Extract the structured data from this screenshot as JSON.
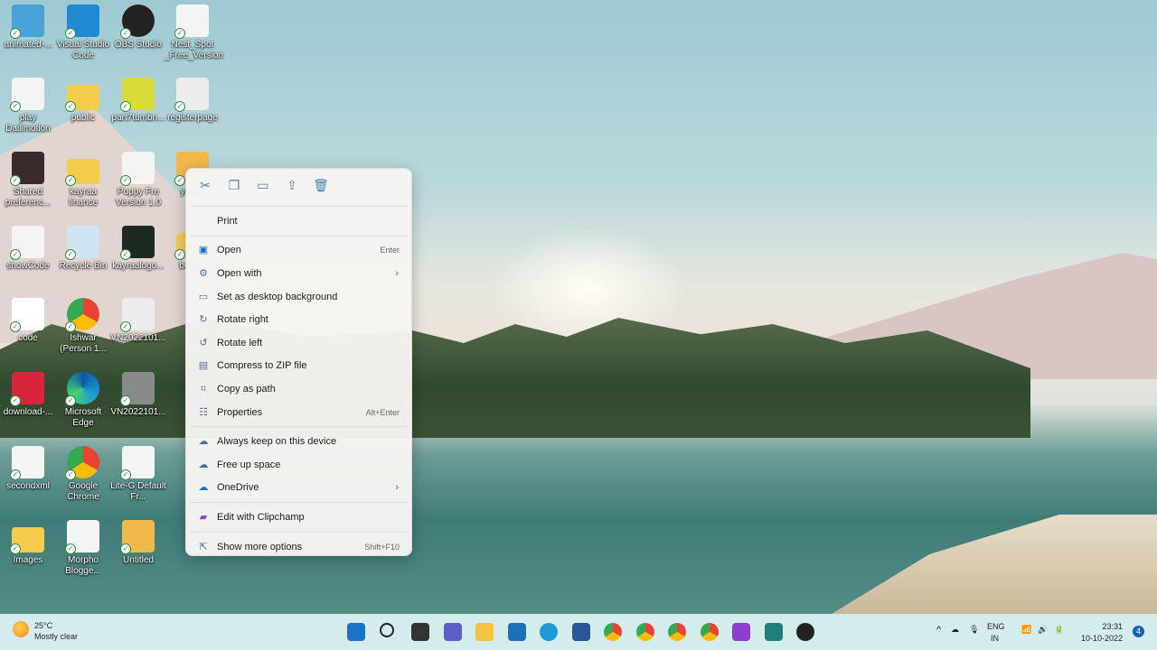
{
  "desktop_icons": [
    {
      "label": "animated-...",
      "type": "image",
      "color": "#4aa3d8",
      "col": 0,
      "row": 0
    },
    {
      "label": "Visual Studio Code",
      "type": "vscode",
      "color": "#1f8ad2",
      "col": 1,
      "row": 0
    },
    {
      "label": "OBS Studio",
      "type": "obs",
      "color": "#222222",
      "col": 2,
      "row": 0
    },
    {
      "label": "Nest_Spot _Free_Version",
      "type": "html",
      "color": "#f4f4f4",
      "col": 3,
      "row": 0
    },
    {
      "label": "play Dailimotion",
      "type": "document",
      "color": "#f4f4f4",
      "col": 0,
      "row": 1
    },
    {
      "label": "public",
      "type": "folder",
      "color": "#f5cd4d",
      "col": 1,
      "row": 1
    },
    {
      "label": "part7tumbn...",
      "type": "image",
      "color": "#d8dc3a",
      "col": 2,
      "row": 1
    },
    {
      "label": "registerpage",
      "type": "document",
      "color": "#ececec",
      "col": 3,
      "row": 1
    },
    {
      "label": "Shared preferenc...",
      "type": "image",
      "color": "#3a2a2a",
      "col": 0,
      "row": 2
    },
    {
      "label": "kayraa finance",
      "type": "folder",
      "color": "#f5cd4d",
      "col": 1,
      "row": 2
    },
    {
      "label": "Poppy Fre Version 1.0",
      "type": "html",
      "color": "#f4f4f4",
      "col": 2,
      "row": 2
    },
    {
      "label": "yout...",
      "type": "image",
      "color": "#f2b84a",
      "col": 3,
      "row": 2
    },
    {
      "label": "showCode",
      "type": "document",
      "color": "#f4f4f4",
      "col": 0,
      "row": 3
    },
    {
      "label": "Recycle Bin",
      "type": "recycle",
      "color": "#cfe4f2",
      "col": 1,
      "row": 3
    },
    {
      "label": "kayraalogo...",
      "type": "image",
      "color": "#1d2a22",
      "col": 2,
      "row": 3
    },
    {
      "label": "besti...",
      "type": "folder",
      "color": "#f5cd4d",
      "col": 3,
      "row": 3
    },
    {
      "label": "code",
      "type": "document",
      "color": "#ffffff",
      "col": 0,
      "row": 4
    },
    {
      "label": "Ishwar (Person 1...",
      "type": "chrome",
      "color": "#e2483a",
      "col": 1,
      "row": 4
    },
    {
      "label": "VN2022101...",
      "type": "document",
      "color": "#ececec",
      "col": 2,
      "row": 4
    },
    {
      "label": "download-...",
      "type": "image",
      "color": "#d8253b",
      "col": 0,
      "row": 5
    },
    {
      "label": "Microsoft Edge",
      "type": "edge",
      "color": "#1d9ad6",
      "col": 1,
      "row": 5
    },
    {
      "label": "VN2022101...",
      "type": "video",
      "color": "#8a8a8a",
      "col": 2,
      "row": 5
    },
    {
      "label": "secondxml",
      "type": "document",
      "color": "#f4f4f4",
      "col": 0,
      "row": 6
    },
    {
      "label": "Google Chrome",
      "type": "chrome",
      "color": "#e2483a",
      "col": 1,
      "row": 6
    },
    {
      "label": "Lite-G Default Fr...",
      "type": "html",
      "color": "#f4f4f4",
      "col": 2,
      "row": 6
    },
    {
      "label": "Images",
      "type": "folder",
      "color": "#f5cd4d",
      "col": 0,
      "row": 7
    },
    {
      "label": "Morpho Blogge...",
      "type": "html",
      "color": "#f4f4f4",
      "col": 1,
      "row": 7
    },
    {
      "label": "Untitled",
      "type": "image",
      "color": "#f2b84a",
      "col": 2,
      "row": 7
    }
  ],
  "context_menu": {
    "toolbar": [
      {
        "name": "cut",
        "glyph": "✂"
      },
      {
        "name": "copy",
        "glyph": "❐"
      },
      {
        "name": "rename",
        "glyph": "▭"
      },
      {
        "name": "share",
        "glyph": "⇪"
      },
      {
        "name": "delete",
        "glyph": "🗑"
      }
    ],
    "groups": [
      [
        {
          "label": "Print",
          "icon": ""
        }
      ],
      [
        {
          "label": "Open",
          "icon": "image",
          "shortcut": "Enter"
        },
        {
          "label": "Open with",
          "icon": "open-with",
          "submenu": true
        },
        {
          "label": "Set as desktop background",
          "icon": "desktop"
        },
        {
          "label": "Rotate right",
          "icon": "rotate-right"
        },
        {
          "label": "Rotate left",
          "icon": "rotate-left"
        },
        {
          "label": "Compress to ZIP file",
          "icon": "zip"
        },
        {
          "label": "Copy as path",
          "icon": "path"
        },
        {
          "label": "Properties",
          "icon": "properties",
          "shortcut": "Alt+Enter"
        }
      ],
      [
        {
          "label": "Always keep on this device",
          "icon": "cloud-keep"
        },
        {
          "label": "Free up space",
          "icon": "cloud"
        },
        {
          "label": "OneDrive",
          "icon": "onedrive",
          "submenu": true
        }
      ],
      [
        {
          "label": "Edit with Clipchamp",
          "icon": "clipchamp"
        }
      ],
      [
        {
          "label": "Show more options",
          "icon": "more",
          "shortcut": "Shift+F10"
        }
      ]
    ]
  },
  "taskbar": {
    "weather": {
      "temp": "25°C",
      "condition": "Mostly clear"
    },
    "apps": [
      {
        "name": "start",
        "color": "#1a73c9"
      },
      {
        "name": "search",
        "color": "#222"
      },
      {
        "name": "task-view",
        "color": "#333"
      },
      {
        "name": "teams-chat",
        "color": "#5b5fc7"
      },
      {
        "name": "file-explorer",
        "color": "#f5c242"
      },
      {
        "name": "store",
        "color": "#1f6fb8"
      },
      {
        "name": "edge",
        "color": "#1d9ad6"
      },
      {
        "name": "word-doc",
        "color": "#2b579a"
      },
      {
        "name": "chrome-profile-1",
        "color": "#e2483a"
      },
      {
        "name": "chrome",
        "color": "#34a853"
      },
      {
        "name": "chrome-profile-2",
        "color": "#fbbc05"
      },
      {
        "name": "chrome-profile-3",
        "color": "#188038"
      },
      {
        "name": "clipchamp",
        "color": "#8b3fd1"
      },
      {
        "name": "app-teal",
        "color": "#1f7f7a"
      },
      {
        "name": "obs",
        "color": "#222"
      }
    ],
    "tray": {
      "lang": "ENG",
      "region": "IN",
      "time": "23:31",
      "date": "10-10-2022",
      "notifications": "4"
    }
  }
}
